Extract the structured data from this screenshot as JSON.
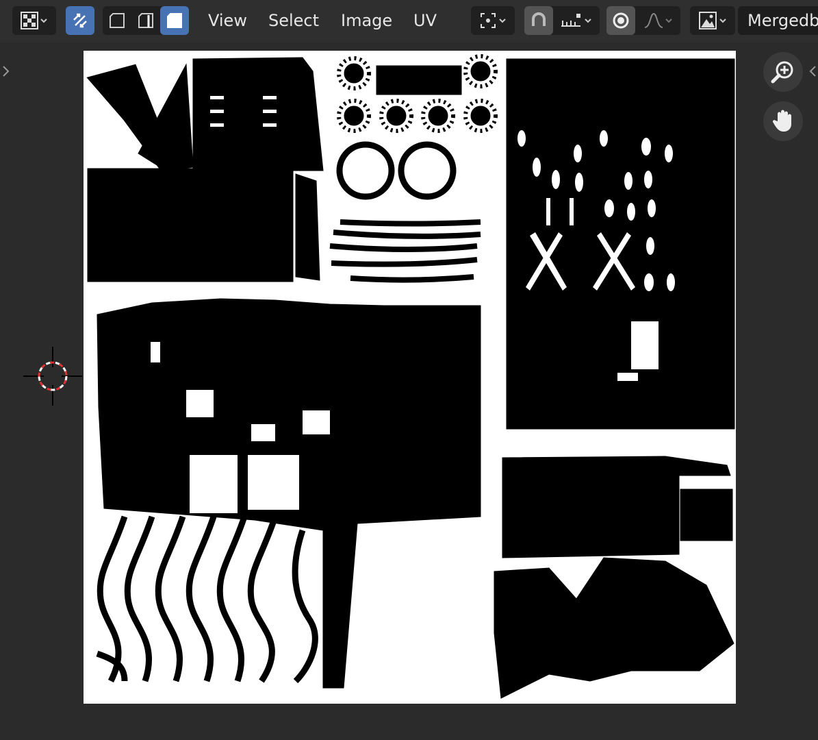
{
  "header": {
    "menus": [
      {
        "label": "View"
      },
      {
        "label": "Select"
      },
      {
        "label": "Image"
      },
      {
        "label": "UV"
      }
    ],
    "image_name": "Mergedb"
  },
  "icons": {
    "editor_type": "checker-editor-icon",
    "sync_selection": "uv-sync-selection-icon",
    "select_mode": [
      "vertex-select-icon",
      "edge-select-icon",
      "face-select-icon"
    ],
    "pivot": "pivot-point-icon",
    "snap": "snap-magnet-icon",
    "snap_target": "snap-increment-icon",
    "proportional": "proportional-edit-icon",
    "falloff": "falloff-curve-icon",
    "image_browse": "image-browse-icon",
    "zoom": "zoom-in-icon",
    "pan": "hand-pan-icon",
    "cursor": "2d-cursor-icon"
  },
  "colors": {
    "accent": "#4772b3",
    "header_bg": "#2f2f2f",
    "viewport_bg": "#2b2b2b",
    "texture_bg": "#ffffff",
    "uv_islands": "#000000"
  }
}
